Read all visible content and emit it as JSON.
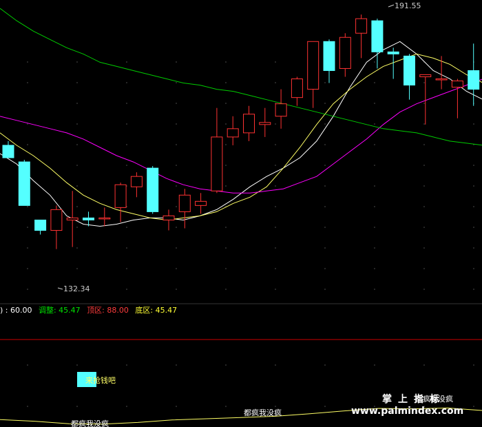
{
  "chart_data": [
    {
      "type": "candlestick",
      "price_range": [
        123,
        196
      ],
      "annotations": {
        "low": "132.34",
        "high": "191.55"
      },
      "candles": [
        {
          "o": 161.0,
          "h": 162.0,
          "l": 158.0,
          "c": 158.0
        },
        {
          "o": 157.0,
          "h": 157.5,
          "l": 146.5,
          "c": 146.5
        },
        {
          "o": 143.0,
          "h": 143.0,
          "l": 139.5,
          "c": 140.5
        },
        {
          "o": 140.5,
          "h": 146.5,
          "l": 136.0,
          "c": 145.5
        },
        {
          "o": 143.0,
          "h": 150.0,
          "l": 136.5,
          "c": 143.5
        },
        {
          "o": 143.5,
          "h": 145.0,
          "l": 141.5,
          "c": 143.0
        },
        {
          "o": 143.5,
          "h": 146.0,
          "l": 141.5,
          "c": 143.5
        },
        {
          "o": 146.0,
          "h": 152.0,
          "l": 142.5,
          "c": 151.5
        },
        {
          "o": 151.0,
          "h": 154.5,
          "l": 148.5,
          "c": 153.5
        },
        {
          "o": 155.5,
          "h": 156.0,
          "l": 144.5,
          "c": 145.0
        },
        {
          "o": 143.0,
          "h": 145.5,
          "l": 140.5,
          "c": 144.0
        },
        {
          "o": 145.0,
          "h": 150.5,
          "l": 141.0,
          "c": 149.0
        },
        {
          "o": 146.5,
          "h": 149.5,
          "l": 144.5,
          "c": 147.5
        },
        {
          "o": 150.0,
          "h": 170.0,
          "l": 149.5,
          "c": 163.0
        },
        {
          "o": 163.0,
          "h": 168.0,
          "l": 161.0,
          "c": 165.0
        },
        {
          "o": 164.0,
          "h": 170.5,
          "l": 162.0,
          "c": 168.5
        },
        {
          "o": 166.0,
          "h": 170.0,
          "l": 163.0,
          "c": 166.5
        },
        {
          "o": 168.0,
          "h": 174.5,
          "l": 165.0,
          "c": 171.0
        },
        {
          "o": 172.5,
          "h": 177.5,
          "l": 170.5,
          "c": 177.0
        },
        {
          "o": 174.5,
          "h": 186.0,
          "l": 170.0,
          "c": 186.0
        },
        {
          "o": 186.0,
          "h": 186.5,
          "l": 176.0,
          "c": 179.0
        },
        {
          "o": 179.5,
          "h": 188.0,
          "l": 177.5,
          "c": 187.0
        },
        {
          "o": 188.0,
          "h": 192.5,
          "l": 182.0,
          "c": 191.5
        },
        {
          "o": 191.0,
          "h": 191.5,
          "l": 179.5,
          "c": 183.5
        },
        {
          "o": 183.5,
          "h": 184.5,
          "l": 177.0,
          "c": 183.0
        },
        {
          "o": 182.5,
          "h": 183.0,
          "l": 172.0,
          "c": 175.5
        },
        {
          "o": 177.5,
          "h": 178.0,
          "l": 166.0,
          "c": 178.0
        },
        {
          "o": 177.0,
          "h": 182.5,
          "l": 174.5,
          "c": 177.0
        },
        {
          "o": 175.0,
          "h": 177.0,
          "l": 167.5,
          "c": 176.5
        },
        {
          "o": 179.0,
          "h": 185.5,
          "l": 170.5,
          "c": 174.5
        },
        {
          "o": 175.0,
          "h": 178.0,
          "l": 171.5,
          "c": 174.0
        }
      ],
      "moving_averages": [
        {
          "color": "#ffffff",
          "values": [
            159.0,
            156.5,
            152.5,
            149.0,
            144.0,
            142.0,
            141.5,
            142.0,
            143.0,
            143.5,
            143.5,
            143.0,
            144.0,
            145.5,
            148.0,
            151.0,
            153.5,
            155.5,
            158.0,
            162.0,
            168.0,
            175.0,
            181.0,
            184.0,
            186.0,
            183.0,
            179.0,
            177.0,
            174.0,
            172.0
          ]
        },
        {
          "color": "#ffff66",
          "values": [
            164.0,
            161.0,
            158.5,
            155.5,
            152.0,
            149.0,
            147.0,
            145.5,
            144.5,
            143.5,
            143.0,
            143.5,
            144.0,
            145.0,
            147.0,
            148.5,
            151.0,
            155.5,
            160.5,
            166.0,
            171.0,
            174.5,
            177.5,
            180.0,
            181.5,
            183.0,
            182.0,
            180.5,
            178.0,
            176.0
          ]
        },
        {
          "color": "#ff00ff",
          "values": [
            168.0,
            167.0,
            166.0,
            165.0,
            164.0,
            162.5,
            160.5,
            158.5,
            157.0,
            155.0,
            153.0,
            151.5,
            150.5,
            150.0,
            149.5,
            149.5,
            150.0,
            150.5,
            152.0,
            153.5,
            156.5,
            159.5,
            162.5,
            166.0,
            169.0,
            171.0,
            172.5,
            174.0,
            175.5,
            177.0
          ]
        },
        {
          "color": "#00cc00",
          "values": [
            194.0,
            191.0,
            188.5,
            186.5,
            184.5,
            183.0,
            181.0,
            180.0,
            179.0,
            178.0,
            177.0,
            176.0,
            175.5,
            174.5,
            174.0,
            173.0,
            172.0,
            171.0,
            170.0,
            169.0,
            168.0,
            167.0,
            166.0,
            165.0,
            164.5,
            164.0,
            163.0,
            162.0,
            161.5,
            161.0
          ]
        }
      ]
    },
    {
      "type": "line",
      "x": [
        0,
        50,
        100,
        150,
        200,
        250,
        300,
        350,
        400,
        450,
        500,
        550,
        600,
        650,
        700
      ],
      "values": [
        18,
        14,
        8,
        7,
        11,
        17,
        20,
        23,
        26,
        32,
        39,
        45,
        44,
        46,
        40
      ],
      "ylim": [
        0,
        100
      ]
    }
  ],
  "indicator_legend": {
    "label_prefix": ") : 60.00",
    "adjust": "调整: 45.47",
    "top_zone": "顶区: 88.00",
    "bottom_zone": "底区: 45.47"
  },
  "signal_text": "来抢钱吧",
  "overlay_texts": [
    "都疯我没疯",
    "都疯我没疯",
    "都疯我没疯"
  ],
  "watermark": {
    "chars": [
      "掌",
      "上",
      "指",
      "标"
    ],
    "url": "www.palmindex.com"
  },
  "colors": {
    "up": "#ff3232",
    "down": "#54ffff",
    "axis_dots": "#555555",
    "red_line": "#cc0000",
    "white_text": "#ffffff",
    "legend_green": "#00e000",
    "legend_red": "#ff3c3c",
    "legend_yellow": "#ffff33"
  }
}
